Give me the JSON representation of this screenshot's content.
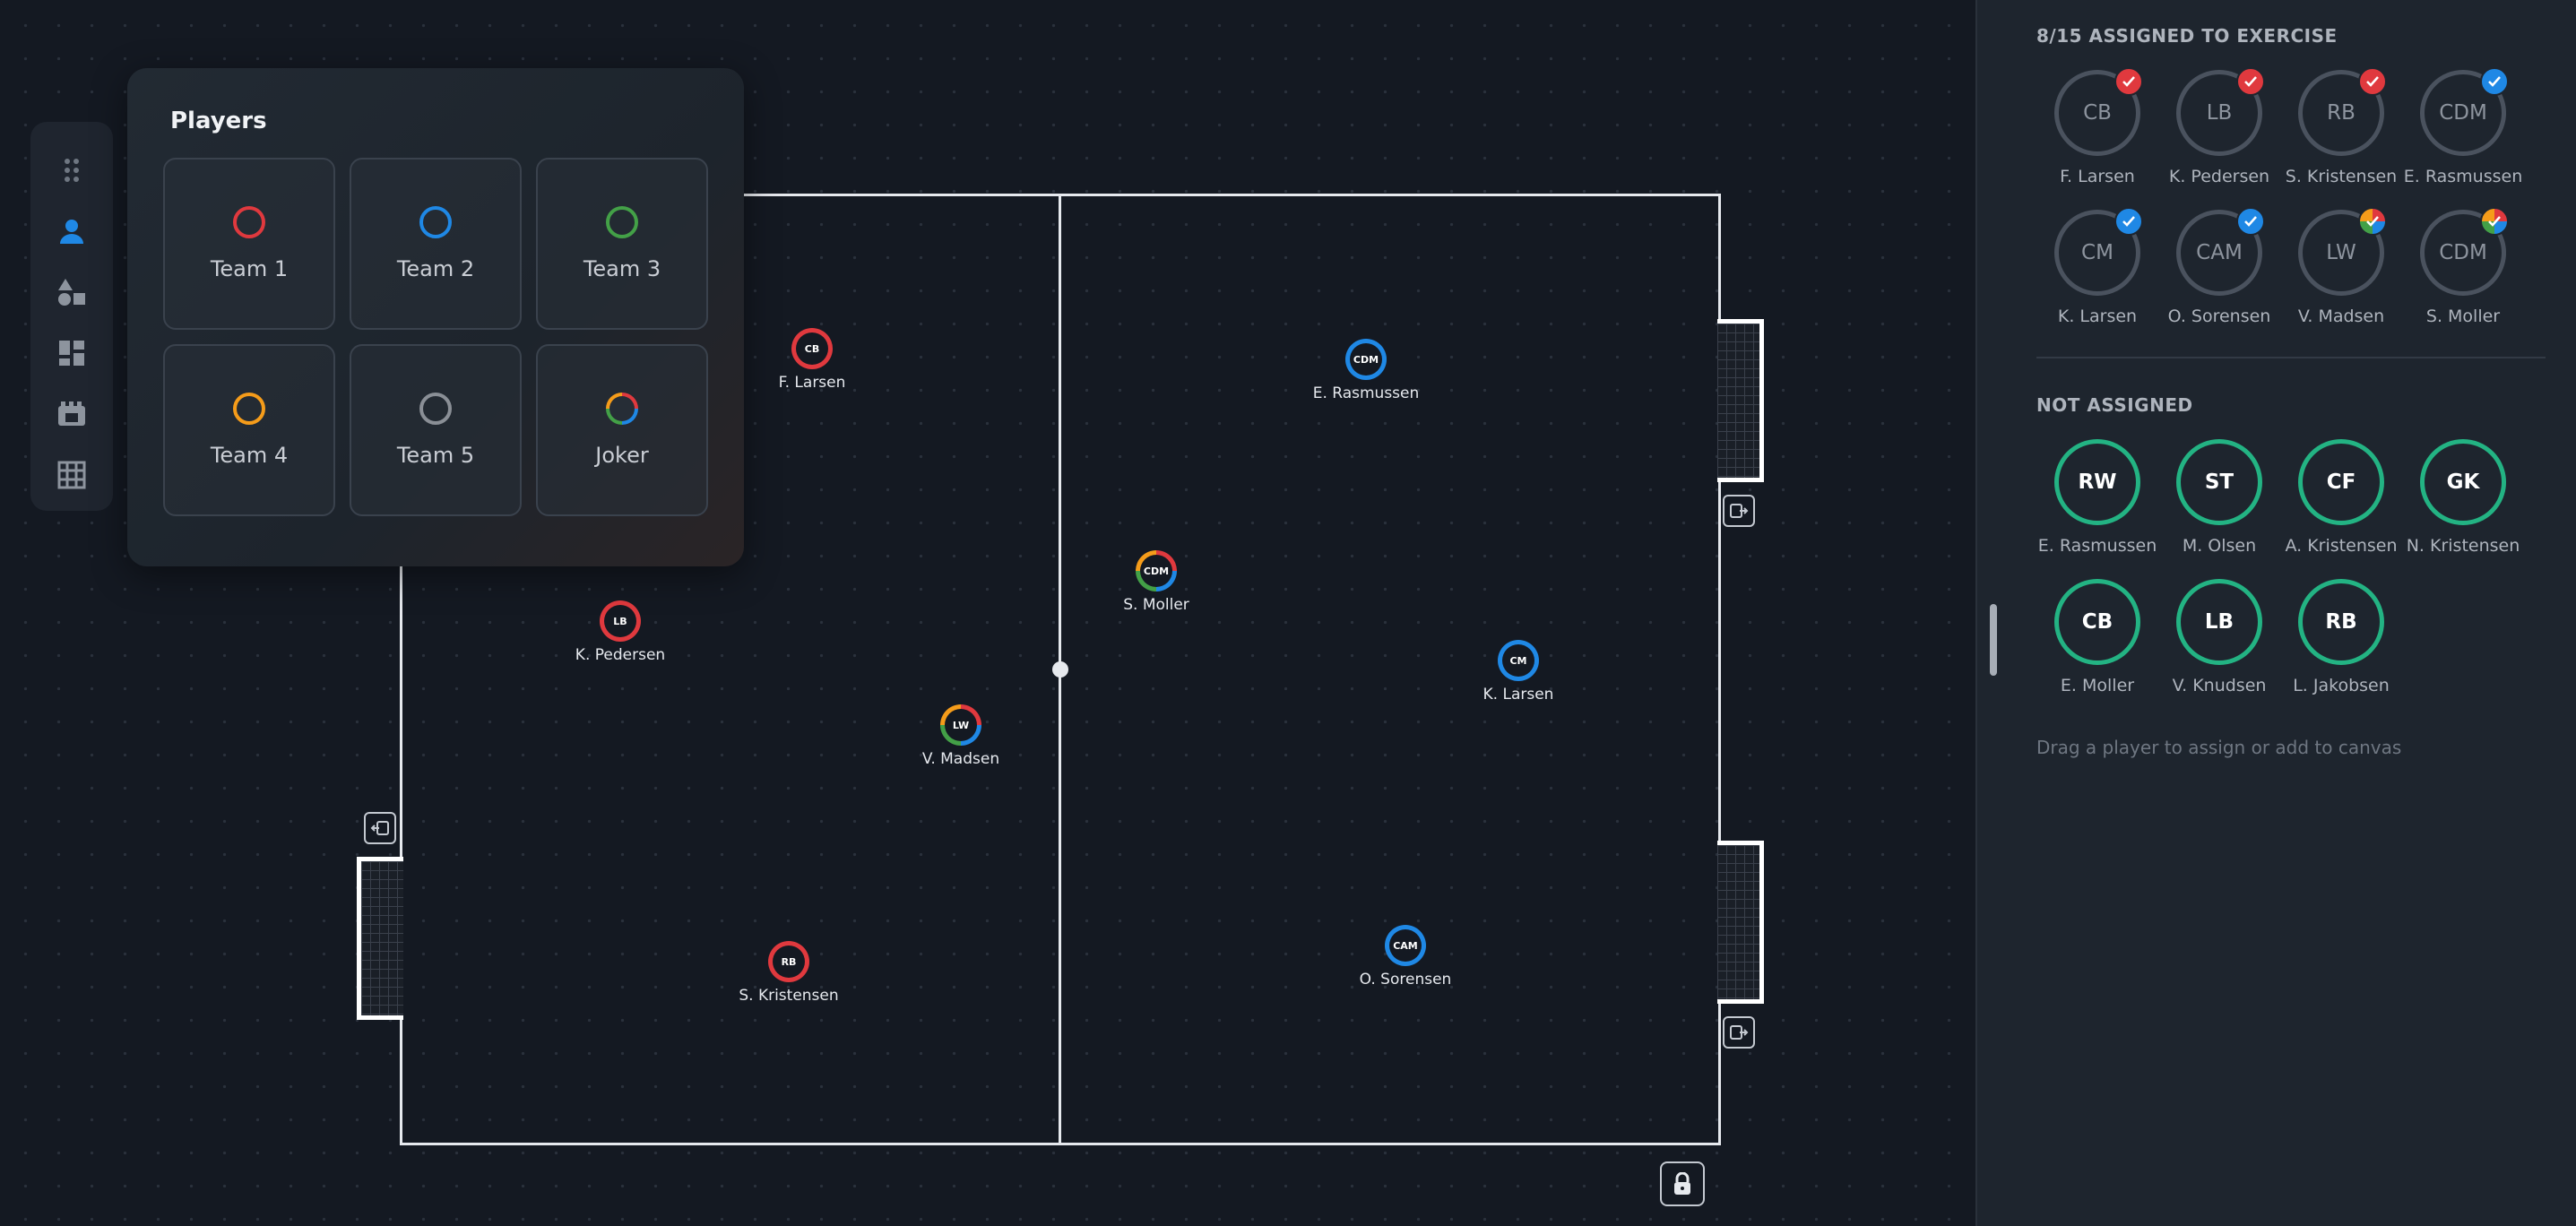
{
  "colors": {
    "team1": "#e0393e",
    "team2": "#1f88e5",
    "team3": "#43a047",
    "team4": "#f59c1a",
    "team5": "#8a8f96",
    "free": "#23b383",
    "accent": "#1f88e5"
  },
  "toolbar": {
    "items": [
      {
        "icon": "drag-handle-icon"
      },
      {
        "icon": "person-icon",
        "active": true
      },
      {
        "icon": "shapes-icon"
      },
      {
        "icon": "layout-icon"
      },
      {
        "icon": "film-icon"
      },
      {
        "icon": "grid-icon"
      }
    ]
  },
  "players_panel": {
    "title": "Players",
    "teams": [
      {
        "label": "Team 1",
        "color": "#e0393e"
      },
      {
        "label": "Team 2",
        "color": "#1f88e5"
      },
      {
        "label": "Team 3",
        "color": "#43a047"
      },
      {
        "label": "Team 4",
        "color": "#f59c1a"
      },
      {
        "label": "Team 5",
        "color": "#8a8f96"
      },
      {
        "label": "Joker",
        "color": "multi"
      }
    ]
  },
  "pitch": {
    "tokens": [
      {
        "pos": "CB",
        "name": "F. Larsen",
        "team": "team1"
      },
      {
        "pos": "LB",
        "name": "K. Pedersen",
        "team": "team1"
      },
      {
        "pos": "RB",
        "name": "S. Kristensen",
        "team": "team1"
      },
      {
        "pos": "LW",
        "name": "V. Madsen",
        "team": "joker"
      },
      {
        "pos": "CDM",
        "name": "S. Moller",
        "team": "joker"
      },
      {
        "pos": "CDM",
        "name": "E. Rasmussen",
        "team": "team2"
      },
      {
        "pos": "CM",
        "name": "K. Larsen",
        "team": "team2"
      },
      {
        "pos": "CAM",
        "name": "O. Sorensen",
        "team": "team2"
      }
    ]
  },
  "sidebar": {
    "assigned_title": "8/15 ASSIGNED TO EXERCISE",
    "assigned": [
      {
        "pos": "CB",
        "name": "F. Larsen",
        "team": "team1"
      },
      {
        "pos": "LB",
        "name": "K. Pedersen",
        "team": "team1"
      },
      {
        "pos": "RB",
        "name": "S. Kristensen",
        "team": "team1"
      },
      {
        "pos": "CDM",
        "name": "E. Rasmussen",
        "team": "team2"
      },
      {
        "pos": "CM",
        "name": "K. Larsen",
        "team": "team2"
      },
      {
        "pos": "CAM",
        "name": "O. Sorensen",
        "team": "team2"
      },
      {
        "pos": "LW",
        "name": "V. Madsen",
        "team": "joker"
      },
      {
        "pos": "CDM",
        "name": "S. Moller",
        "team": "joker"
      }
    ],
    "not_assigned_title": "NOT ASSIGNED",
    "not_assigned": [
      {
        "pos": "RW",
        "name": "E. Rasmussen"
      },
      {
        "pos": "ST",
        "name": "M. Olsen"
      },
      {
        "pos": "CF",
        "name": "A. Kristensen"
      },
      {
        "pos": "GK",
        "name": "N. Kristensen"
      },
      {
        "pos": "CB",
        "name": "E. Moller"
      },
      {
        "pos": "LB",
        "name": "V. Knudsen"
      },
      {
        "pos": "RB",
        "name": "L. Jakobsen"
      }
    ],
    "hint": "Drag a player to assign or add to canvas"
  }
}
